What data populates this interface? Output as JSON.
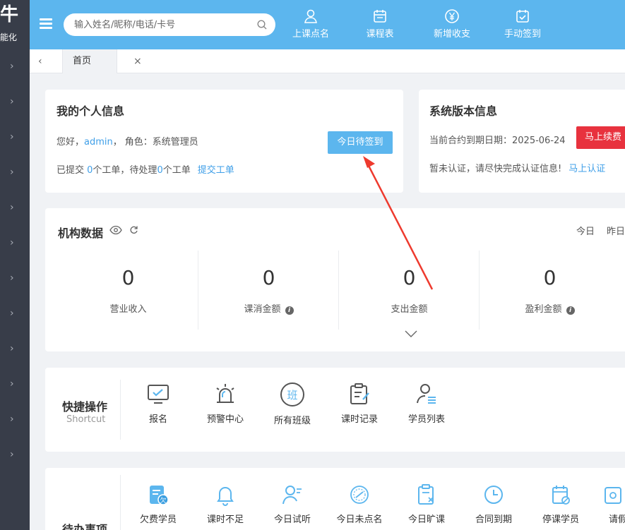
{
  "brand": {
    "char": "牛",
    "sub": "能化"
  },
  "search": {
    "placeholder": "输入姓名/昵称/电话/卡号"
  },
  "top_actions": [
    {
      "label": "上课点名",
      "icon": "person-icon"
    },
    {
      "label": "课程表",
      "icon": "calendar-icon"
    },
    {
      "label": "新增收支",
      "icon": "yuan-icon"
    },
    {
      "label": "手动签到",
      "icon": "calendar-check-icon"
    }
  ],
  "tabs": {
    "home": "首页",
    "close": "×"
  },
  "personal": {
    "title": "我的个人信息",
    "greeting": "您好，",
    "username": "admin",
    "role_sep": "，",
    "role": "角色：系统管理员",
    "checkin_button": "今日待签到",
    "tickets_prefix": "已提交 ",
    "submitted_count": "0",
    "tickets_mid": "个工单，待处理",
    "pending_count": "0",
    "tickets_suffix": "个工单",
    "submit_ticket": "提交工单"
  },
  "version": {
    "title": "系统版本信息",
    "expiry": "当前合约到期日期：2025-06-24",
    "renew_button": "马上续费",
    "auth_notice": "暂未认证，请尽快完成认证信息!",
    "auth_link": "马上认证"
  },
  "org": {
    "title": "机构数据",
    "range_today": "今日",
    "range_yesterday": "昨日",
    "stats": [
      {
        "value": "0",
        "label": "营业收入",
        "info": false
      },
      {
        "value": "0",
        "label": "课消金额",
        "info": true
      },
      {
        "value": "0",
        "label": "支出金额",
        "info": false
      },
      {
        "value": "0",
        "label": "盈利金额",
        "info": true
      }
    ],
    "info_glyph": "i"
  },
  "quick": {
    "title": "快捷操作",
    "subtitle": "Shortcut",
    "items": [
      {
        "label": "报名",
        "icon": "monitor-check-icon"
      },
      {
        "label": "预警中心",
        "icon": "alarm-light-icon"
      },
      {
        "label": "所有班级",
        "icon": "class-badge-icon",
        "badge": "班"
      },
      {
        "label": "课时记录",
        "icon": "clipboard-edit-icon"
      },
      {
        "label": "学员列表",
        "icon": "user-list-icon"
      }
    ]
  },
  "todo": {
    "title": "待办事项",
    "items": [
      {
        "label": "欠费学员",
        "icon": "owe-document-icon",
        "badge": "欠"
      },
      {
        "label": "课时不足",
        "icon": "bell-icon"
      },
      {
        "label": "今日试听",
        "icon": "user-audition-icon"
      },
      {
        "label": "今日未点名",
        "icon": "stamp-icon"
      },
      {
        "label": "今日旷课",
        "icon": "clipboard-x-icon"
      },
      {
        "label": "合同到期",
        "icon": "clock-icon"
      },
      {
        "label": "停课学员",
        "icon": "calendar-stop-icon"
      },
      {
        "label": "请假",
        "icon": "leave-icon"
      }
    ]
  },
  "colors": {
    "accent": "#5cb6ee",
    "sidebar": "#383d49",
    "danger": "#e8323e",
    "link": "#3f9fe8",
    "arrow": "#ee3a2e"
  }
}
